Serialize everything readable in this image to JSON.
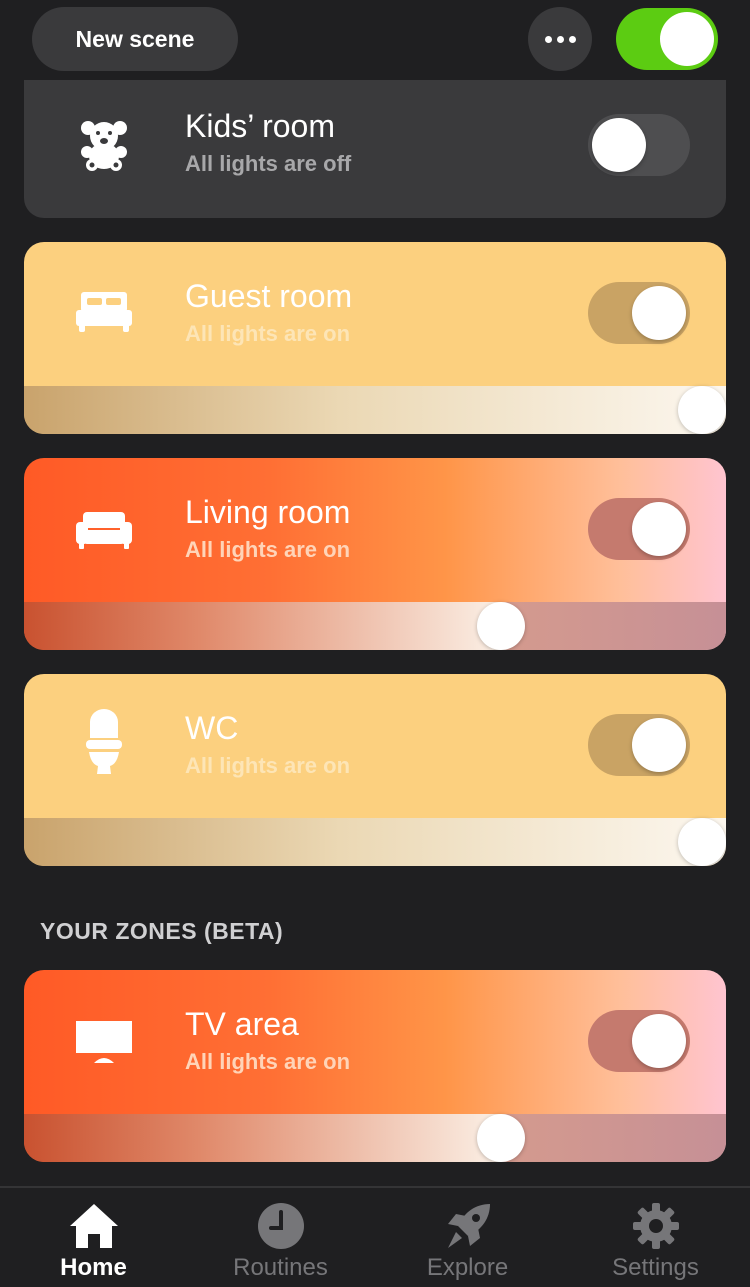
{
  "header": {
    "new_scene_label": "New scene",
    "more_icon": "more-dots-icon",
    "master_toggle_on": true
  },
  "rooms": [
    {
      "name": "Kids’ room",
      "status": "All lights are off",
      "icon": "teddy-bear-icon",
      "on": false
    },
    {
      "name": "Guest room",
      "status": "All lights are on",
      "icon": "bed-icon",
      "on": true,
      "brightness_pct": 100
    },
    {
      "name": "Living room",
      "status": "All lights are on",
      "icon": "sofa-icon",
      "on": true,
      "brightness_pct": 68
    },
    {
      "name": "WC",
      "status": "All lights are on",
      "icon": "toilet-icon",
      "on": true,
      "brightness_pct": 100
    }
  ],
  "zones_section_title": "YOUR ZONES (BETA)",
  "zones": [
    {
      "name": "TV area",
      "status": "All lights are on",
      "icon": "tv-icon",
      "on": true,
      "brightness_pct": 68
    }
  ],
  "tabs": [
    {
      "label": "Home",
      "icon": "home-icon",
      "active": true
    },
    {
      "label": "Routines",
      "icon": "clock-icon",
      "active": false
    },
    {
      "label": "Explore",
      "icon": "rocket-icon",
      "active": false
    },
    {
      "label": "Settings",
      "icon": "gear-icon",
      "active": false
    }
  ],
  "colors": {
    "background": "#1f1f21",
    "card_dark": "#3a3a3c",
    "toggle_on_green": "#5ccc12",
    "warm_card": "#fcd07f",
    "orange_card": "#ff5a26"
  }
}
